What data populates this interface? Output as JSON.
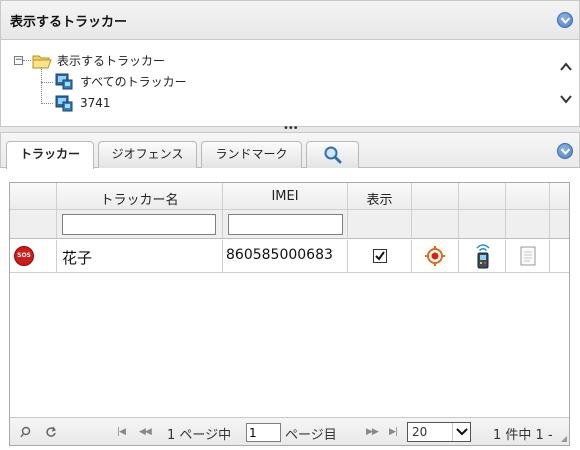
{
  "top_panel": {
    "title": "表示するトラッカー",
    "tree": {
      "root_label": "表示するトラッカー",
      "children": [
        {
          "label": "すべてのトラッカー"
        },
        {
          "label": "3741"
        }
      ]
    }
  },
  "tabs": [
    {
      "label": "トラッカー",
      "active": true
    },
    {
      "label": "ジオフェンス",
      "active": false
    },
    {
      "label": "ランドマーク",
      "active": false
    }
  ],
  "grid": {
    "columns": [
      "トラッカー名",
      "IMEI",
      "表示"
    ],
    "filters": {
      "name_value": "",
      "imei_value": ""
    },
    "rows": [
      {
        "status_icon_text": "SOS",
        "name": "花子",
        "imei": "860585000683",
        "visible": true
      }
    ]
  },
  "pager": {
    "page_prefix": "1 ページ中",
    "page_value": "1",
    "page_suffix": "ページ目",
    "page_size": "20",
    "count_text": "1 件中 1 -"
  },
  "colors": {
    "accent": "#4b7fc6",
    "sos": "#d11a1a"
  }
}
